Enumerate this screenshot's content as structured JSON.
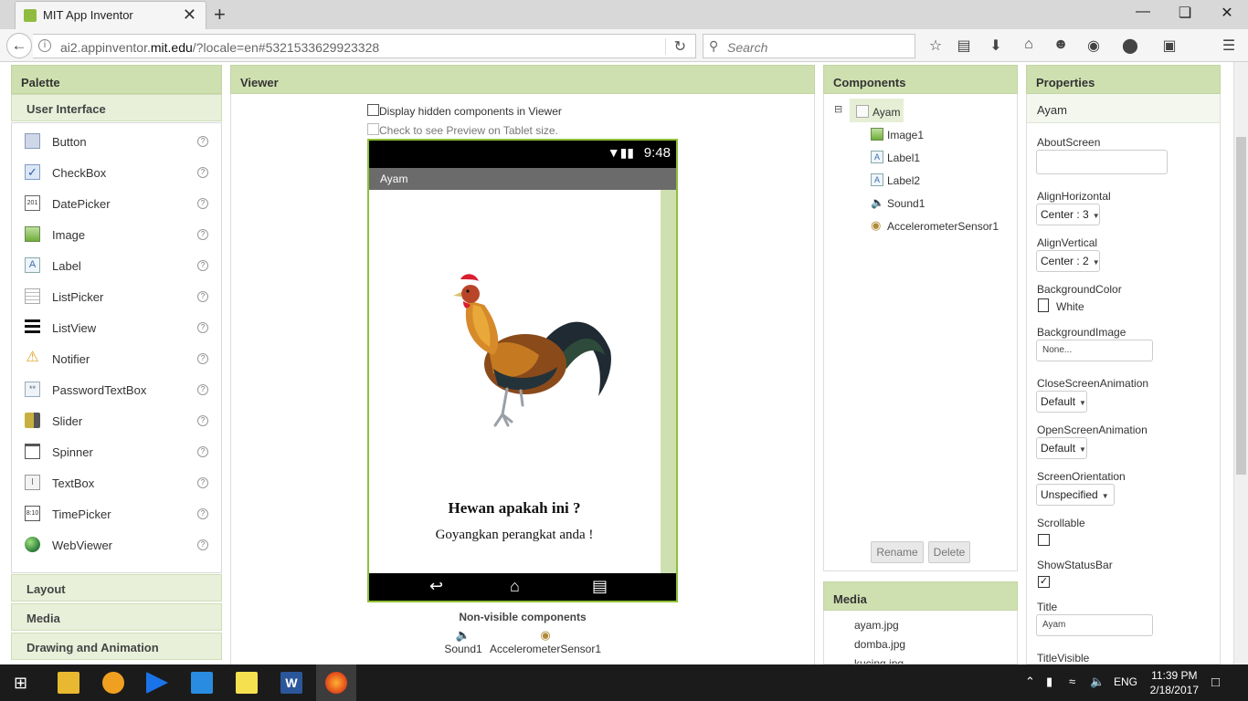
{
  "browser": {
    "tab_title": "MIT App Inventor",
    "url_host_prefix": "ai2.appinventor.",
    "url_host_main": "mit.edu",
    "url_path": "/?locale=en#5321533629923328",
    "search_placeholder": "Search"
  },
  "palette": {
    "header": "Palette",
    "section_open": "User Interface",
    "items": [
      "Button",
      "CheckBox",
      "DatePicker",
      "Image",
      "Label",
      "ListPicker",
      "ListView",
      "Notifier",
      "PasswordTextBox",
      "Slider",
      "Spinner",
      "TextBox",
      "TimePicker",
      "WebViewer"
    ],
    "sections_closed": [
      "Layout",
      "Media",
      "Drawing and Animation"
    ]
  },
  "viewer": {
    "header": "Viewer",
    "display_hidden": "Display hidden components in Viewer",
    "tablet_preview": "Check to see Preview on Tablet size.",
    "phone_time": "9:48",
    "screen_title": "Ayam",
    "question": "Hewan apakah ini ?",
    "instruction": "Goyangkan perangkat anda !",
    "nonvisible_title": "Non-visible components",
    "nonvisible": [
      "Sound1",
      "AccelerometerSensor1"
    ]
  },
  "components": {
    "header": "Components",
    "root": "Ayam",
    "children": [
      "Image1",
      "Label1",
      "Label2",
      "Sound1",
      "AccelerometerSensor1"
    ],
    "rename": "Rename",
    "delete": "Delete"
  },
  "media": {
    "header": "Media",
    "files": [
      "ayam.jpg",
      "domba.jpg",
      "kucing.jpg"
    ]
  },
  "properties": {
    "header": "Properties",
    "component": "Ayam",
    "about_screen_label": "AboutScreen",
    "align_h_label": "AlignHorizontal",
    "align_h_value": "Center : 3",
    "align_v_label": "AlignVertical",
    "align_v_value": "Center : 2",
    "bgcolor_label": "BackgroundColor",
    "bgcolor_value": "White",
    "bgimage_label": "BackgroundImage",
    "bgimage_value": "None...",
    "close_anim_label": "CloseScreenAnimation",
    "close_anim_value": "Default",
    "open_anim_label": "OpenScreenAnimation",
    "open_anim_value": "Default",
    "orientation_label": "ScreenOrientation",
    "orientation_value": "Unspecified",
    "scrollable_label": "Scrollable",
    "show_status_label": "ShowStatusBar",
    "title_label": "Title",
    "title_value": "Ayam",
    "title_visible_label": "TitleVisible"
  },
  "taskbar": {
    "lang": "ENG",
    "time": "11:39 PM",
    "date": "2/18/2017"
  },
  "colors": {
    "panel_header": "#cfe0b0",
    "phone_border": "#8fc03a"
  }
}
